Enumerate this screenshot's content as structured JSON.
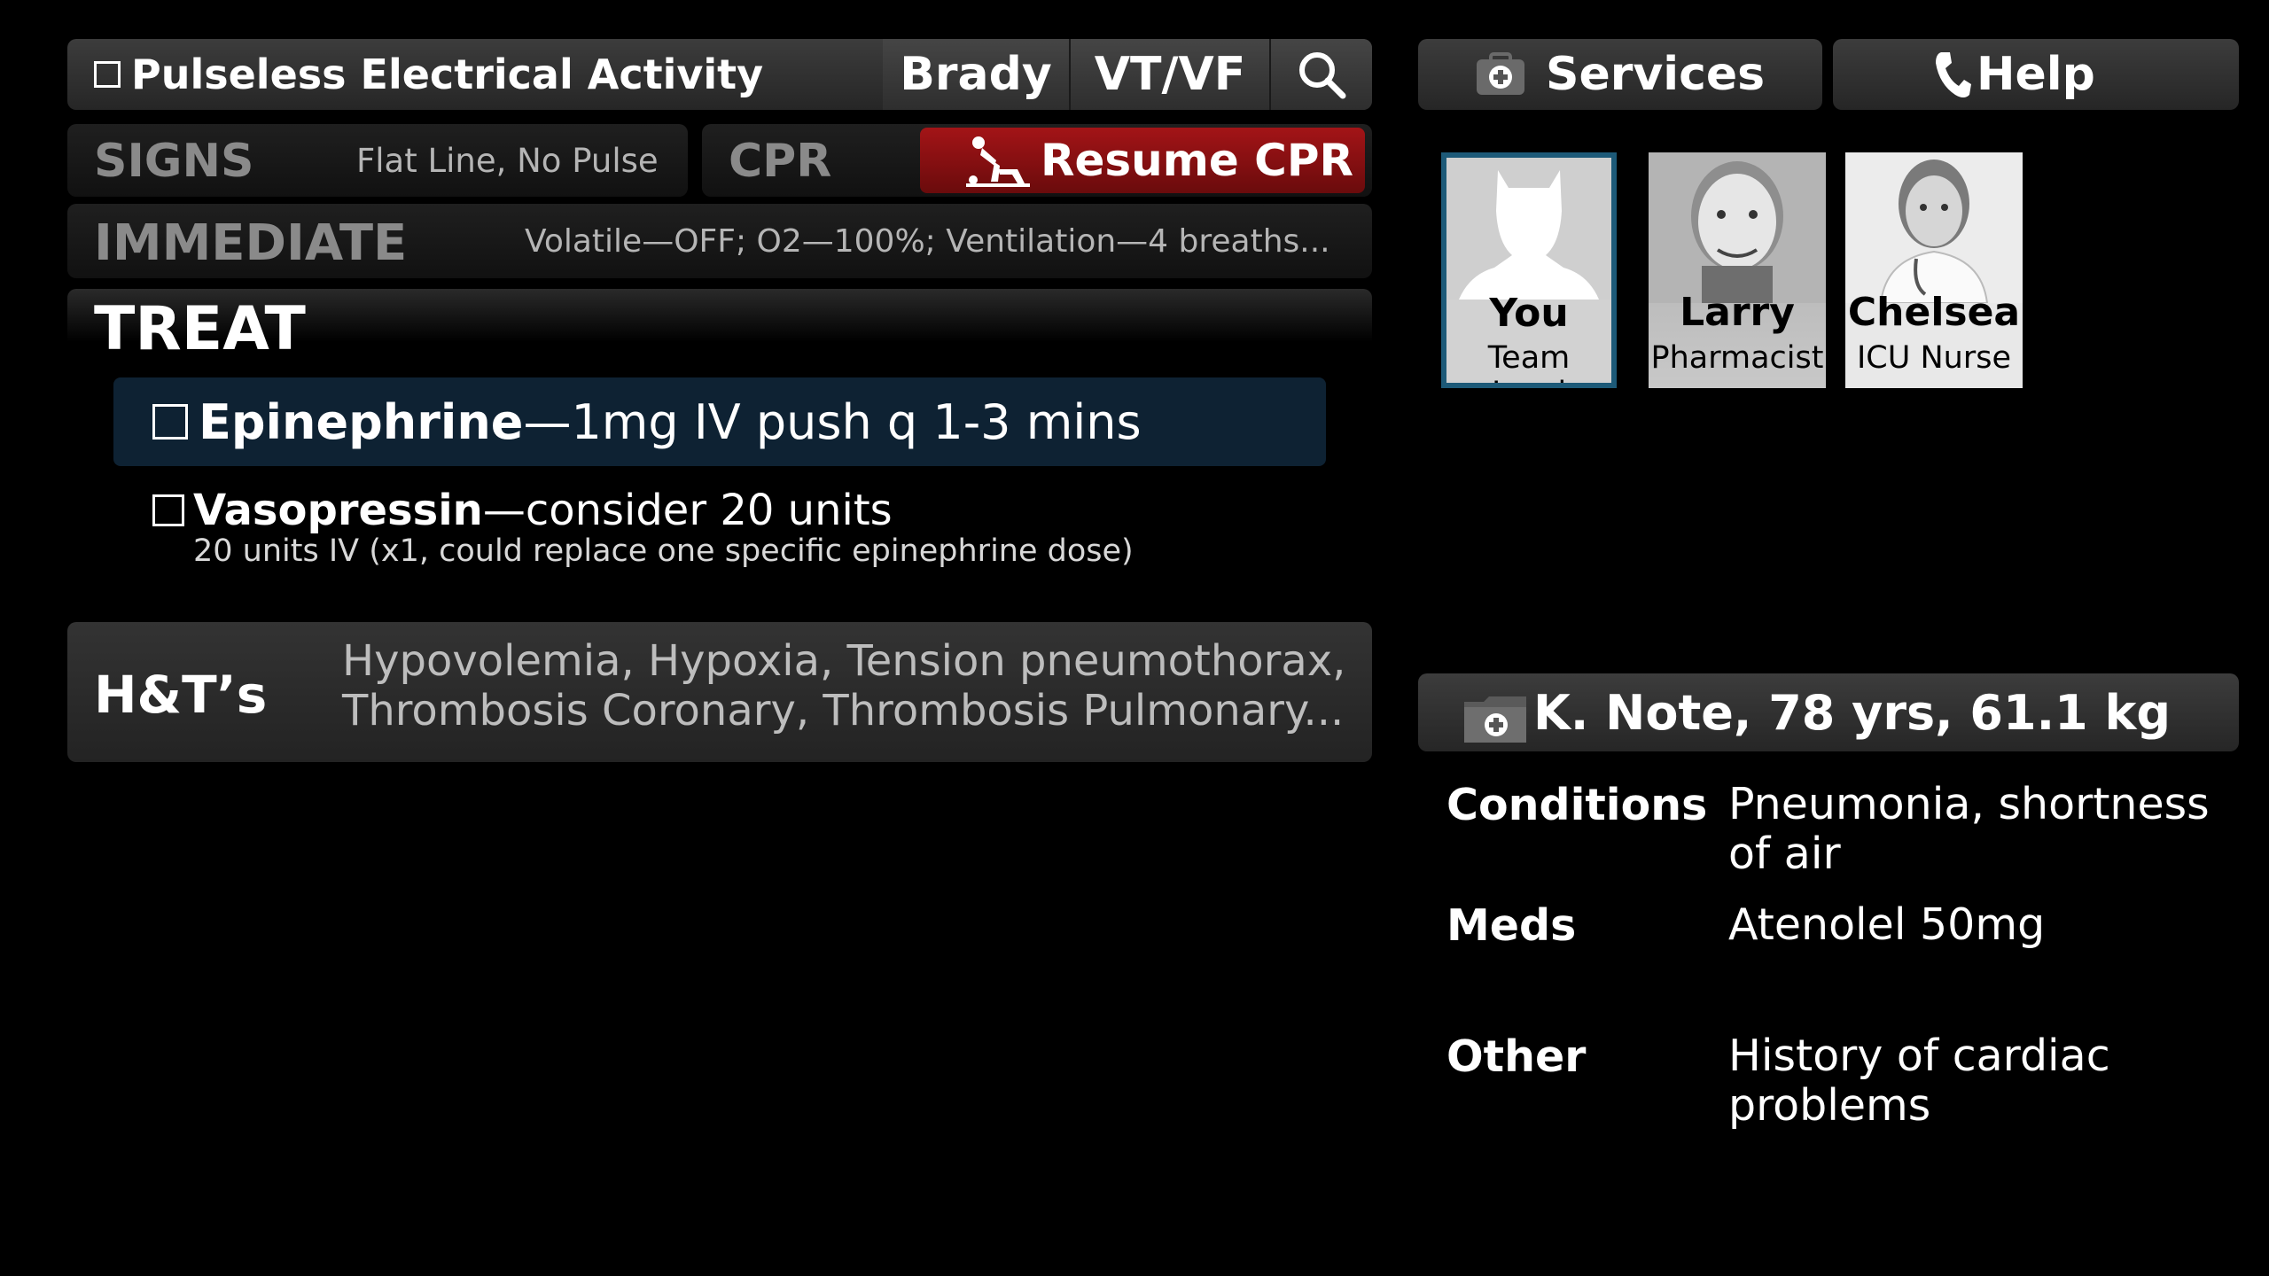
{
  "header": {
    "protocol_title": "Pulseless Electrical Activity",
    "tabs": [
      "Brady",
      "VT/VF"
    ],
    "search_icon": "search-icon",
    "services_label": "Services",
    "help_label": "Help"
  },
  "signs": {
    "label": "SIGNS",
    "value": "Flat Line, No Pulse"
  },
  "cpr": {
    "label": "CPR",
    "button_label": "Resume CPR",
    "button_color": "#8a0f10"
  },
  "immediate": {
    "label": "IMMEDIATE",
    "value": "Volatile—OFF; O2—100%; Ventilation—4 breaths..."
  },
  "treat": {
    "label": "TREAT",
    "items": [
      {
        "drug": "Epinephrine",
        "dose": "—1mg IV push q 1-3 mins",
        "note": ""
      },
      {
        "drug": "Vasopressin",
        "dose": "—consider 20 units",
        "note": "20 units IV (x1, could replace one specific epinephrine dose)"
      }
    ],
    "highlight_color": "#0e2233"
  },
  "hts": {
    "label": "H&T’s",
    "line1": "Hypovolemia, Hypoxia, Tension pneumothorax,",
    "line2": "Thrombosis Coronary, Thrombosis Pulmonary..."
  },
  "team": [
    {
      "name": "You",
      "role": "Team Lead"
    },
    {
      "name": "Larry",
      "role": "Pharmacist"
    },
    {
      "name": "Chelsea",
      "role": "ICU Nurse"
    }
  ],
  "patient": {
    "header": "K. Note, 78 yrs, 61.1 kg",
    "conditions_label": "Conditions",
    "conditions_line1": "Pneumonia, shortness",
    "conditions_line2": "of air",
    "meds_label": "Meds",
    "meds_value": "Atenolel 50mg",
    "other_label": "Other",
    "other_line1": "History of cardiac",
    "other_line2": "problems"
  }
}
